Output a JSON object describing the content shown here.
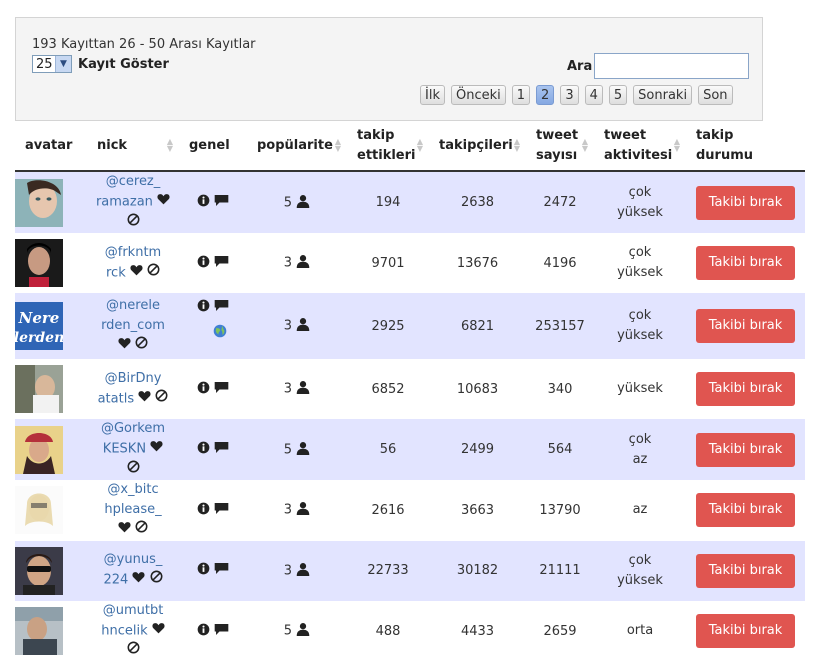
{
  "panel": {
    "records_info": "193 Kayıttan 26 - 50 Arası Kayıtlar",
    "length_value": "25",
    "length_label": "Kayıt Göster",
    "search_label": "Ara",
    "search_value": ""
  },
  "pager": [
    "İlk",
    "Önceki",
    "1",
    "2",
    "3",
    "4",
    "5",
    "Sonraki",
    "Son"
  ],
  "pager_active": "2",
  "headers": {
    "avatar": "avatar",
    "nick": "nick",
    "genel": "genel",
    "popularite": "popülarite",
    "takip_ettikleri_1": "takip",
    "takip_ettikleri_2": "ettikleri",
    "takipcileri": "takipçileri",
    "tweet_sayisi_1": "tweet",
    "tweet_sayisi_2": "sayısı",
    "tweet_aktivitesi_1": "tweet",
    "tweet_aktivitesi_2": "aktivitesi",
    "takip_durumu_1": "takip",
    "takip_durumu_2": "durumu"
  },
  "unfollow_label": "Takibi bırak",
  "rows": [
    {
      "nick1": "@cerez_",
      "nick2": "ramazan",
      "pop": "5",
      "takip": "194",
      "takipci": "2638",
      "tweet": "2472",
      "akt1": "çok",
      "akt2": "yüksek"
    },
    {
      "nick1": "@frkntm",
      "nick2": "rck",
      "pop": "3",
      "takip": "9701",
      "takipci": "13676",
      "tweet": "4196",
      "akt1": "çok",
      "akt2": "yüksek"
    },
    {
      "nick1": "@nerele",
      "nick2": "rden_com",
      "pop": "3",
      "takip": "2925",
      "takipci": "6821",
      "tweet": "253157",
      "akt1": "çok",
      "akt2": "yüksek"
    },
    {
      "nick1": "@BirDny",
      "nick2": "atatls",
      "pop": "3",
      "takip": "6852",
      "takipci": "10683",
      "tweet": "340",
      "akt1": "yüksek",
      "akt2": ""
    },
    {
      "nick1": "@Gorkem",
      "nick2": "KESKN",
      "pop": "5",
      "takip": "56",
      "takipci": "2499",
      "tweet": "564",
      "akt1": "çok",
      "akt2": "az"
    },
    {
      "nick1": "@x_bitc",
      "nick2": "hplease_",
      "pop": "3",
      "takip": "2616",
      "takipci": "3663",
      "tweet": "13790",
      "akt1": "az",
      "akt2": ""
    },
    {
      "nick1": "@yunus_",
      "nick2": "224",
      "pop": "3",
      "takip": "22733",
      "takipci": "30182",
      "tweet": "21111",
      "akt1": "çok",
      "akt2": "yüksek"
    },
    {
      "nick1": "@umutbt",
      "nick2": "hncelik",
      "pop": "5",
      "takip": "488",
      "takipci": "4433",
      "tweet": "2659",
      "akt1": "orta",
      "akt2": ""
    }
  ],
  "avatar_logo_text": {
    "line1": "Nere",
    "line2": "lerden"
  },
  "icons": {
    "heart": "heart-icon",
    "ban": "ban-icon",
    "info": "info-icon",
    "comment": "comment-icon",
    "user": "user-icon",
    "globe": "globe-icon"
  },
  "colors": {
    "odd_row": "#e2e4ff",
    "button": "#e05550",
    "link": "#3f6fa7",
    "active_page": "#92b1e6"
  }
}
